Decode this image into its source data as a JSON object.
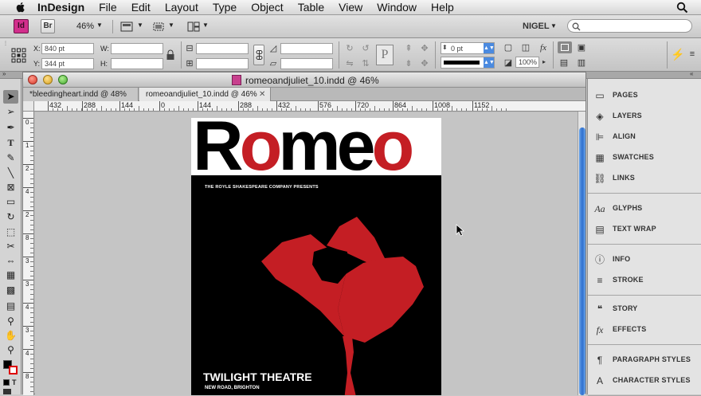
{
  "menubar": {
    "app": "InDesign",
    "items": [
      "File",
      "Edit",
      "Layout",
      "Type",
      "Object",
      "Table",
      "View",
      "Window",
      "Help"
    ]
  },
  "appbar": {
    "app_badge": "Id",
    "bridge_badge": "Br",
    "zoom": "46%",
    "user": "NIGEL",
    "search_placeholder": ""
  },
  "control": {
    "x_label": "X:",
    "x_value": "840 pt",
    "y_label": "Y:",
    "y_value": "344 pt",
    "w_label": "W:",
    "h_label": "H:",
    "stroke_weight": "0 pt",
    "opacity": "100%"
  },
  "document": {
    "title": "romeoandjuliet_10.indd @ 46%",
    "tabs": [
      {
        "label": "*bleedingheart.indd @ 48%",
        "active": false
      },
      {
        "label": "romeoandjuliet_10.indd @ 46%",
        "active": true
      }
    ],
    "hruler_ticks": [
      "432",
      "288",
      "144",
      "0",
      "144",
      "288",
      "432",
      "576",
      "720",
      "864",
      "1008",
      "1152"
    ],
    "vruler_ticks": [
      "0",
      "1",
      "2",
      "4",
      "2",
      "8",
      "3",
      "3",
      "4",
      "3",
      "4",
      "8"
    ]
  },
  "poster": {
    "title_parts": [
      "R",
      "o",
      "me",
      "o"
    ],
    "presents": "THE ROYLE SHAKESPEARE COMPANY PRESENTS",
    "venue": "TWILIGHT THEATRE",
    "address": "NEW ROAD, BRIGHTON",
    "accent_color": "#c41e24"
  },
  "panels": {
    "groups": [
      [
        {
          "label": "PAGES",
          "icon": "pages-icon"
        },
        {
          "label": "LAYERS",
          "icon": "layers-icon"
        },
        {
          "label": "ALIGN",
          "icon": "align-icon"
        },
        {
          "label": "SWATCHES",
          "icon": "swatches-icon"
        },
        {
          "label": "LINKS",
          "icon": "links-icon"
        }
      ],
      [
        {
          "label": "GLYPHS",
          "icon": "glyphs-icon"
        },
        {
          "label": "TEXT WRAP",
          "icon": "text-wrap-icon"
        }
      ],
      [
        {
          "label": "INFO",
          "icon": "info-icon"
        },
        {
          "label": "STROKE",
          "icon": "stroke-icon"
        }
      ],
      [
        {
          "label": "STORY",
          "icon": "story-icon"
        },
        {
          "label": "EFFECTS",
          "icon": "effects-icon"
        }
      ],
      [
        {
          "label": "PARAGRAPH STYLES",
          "icon": "paragraph-styles-icon"
        },
        {
          "label": "CHARACTER STYLES",
          "icon": "character-styles-icon"
        }
      ]
    ]
  }
}
